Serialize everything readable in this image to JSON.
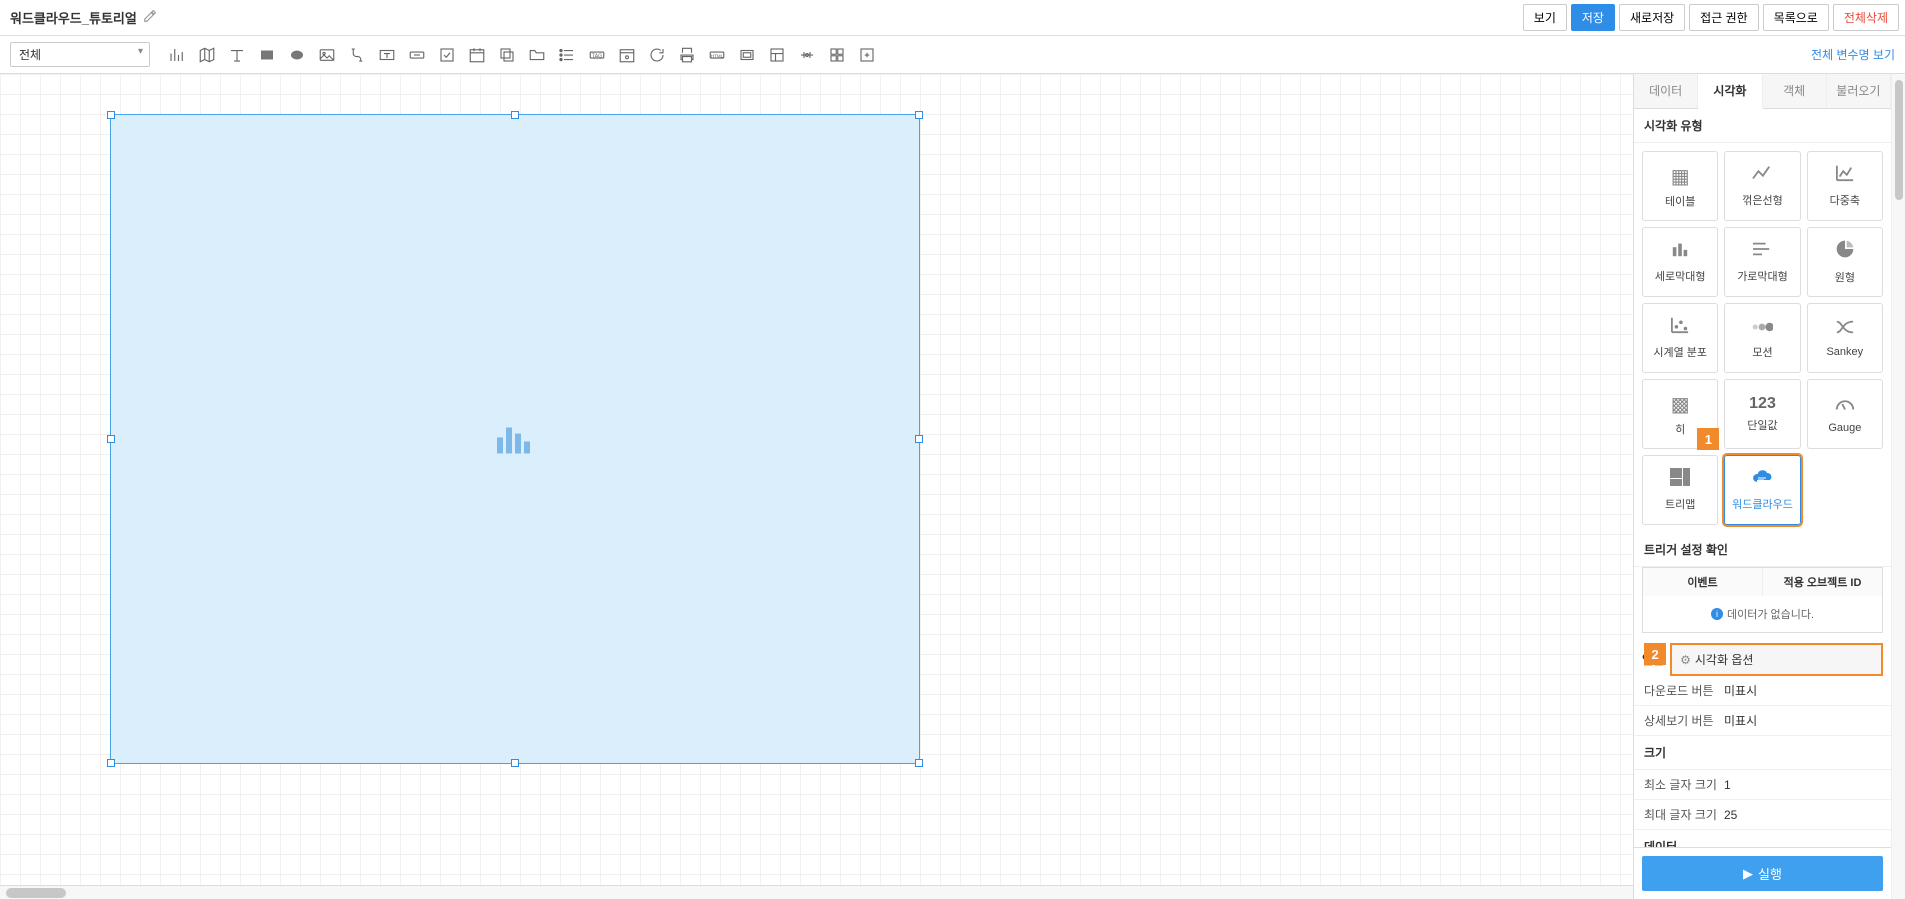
{
  "header": {
    "title": "워드클라우드_튜토리얼",
    "buttons": {
      "view": "보기",
      "save": "저장",
      "save_as": "새로저장",
      "access": "접근 권한",
      "list": "목록으로",
      "delete_all": "전체삭제"
    }
  },
  "toolbar": {
    "scope_select": "전체",
    "var_link": "전체 변수명 보기"
  },
  "panel": {
    "tabs": {
      "data": "데이터",
      "visual": "시각화",
      "object": "객체",
      "import": "불러오기"
    },
    "vis_type_title": "시각화 유형",
    "vis_types": {
      "table": "테이블",
      "line": "꺾은선형",
      "multiaxis": "다중축",
      "vbar": "세로막대형",
      "hbar": "가로막대형",
      "pie": "원형",
      "timeseries": "시계열 분포",
      "motion": "모션",
      "sankey": "Sankey",
      "heatmap": "히",
      "single": "단일값",
      "gauge": "Gauge",
      "treemap": "트리맵",
      "wordcloud": "워드클라우드"
    },
    "trigger_title": "트리거 설정 확인",
    "trigger_cols": {
      "event": "이벤트",
      "target": "적용 오브젝트 ID"
    },
    "trigger_empty": "데이터가 없습니다.",
    "general_label": "일반",
    "vis_option_label": "시각화 옵션",
    "general": {
      "download_label": "다운로드 버튼",
      "download_value": "미표시",
      "detail_label": "상세보기 버튼",
      "detail_value": "미표시"
    },
    "size_title": "크기",
    "size": {
      "min_label": "최소 글자 크기",
      "min_value": "1",
      "max_label": "최대 글자 크기",
      "max_value": "25"
    },
    "data_title": "데이터",
    "run_label": "실행"
  },
  "annotations": {
    "one": "1",
    "two": "2"
  }
}
